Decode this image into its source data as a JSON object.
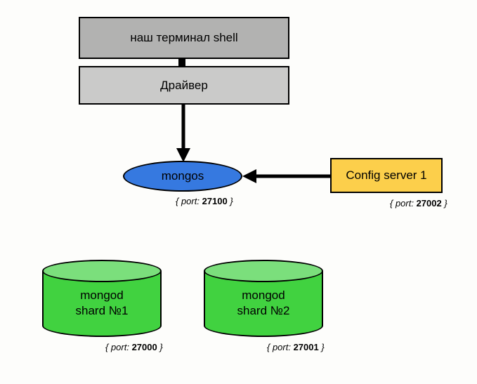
{
  "terminal": {
    "label": "наш терминал shell"
  },
  "driver": {
    "label": "Драйвер"
  },
  "mongos": {
    "label": "mongos",
    "port": "27100"
  },
  "config": {
    "label": "Config server 1",
    "port": "27002"
  },
  "shard1": {
    "label1": "mongod",
    "label2": "shard №1",
    "port": "27000"
  },
  "shard2": {
    "label1": "mongod",
    "label2": "shard №2",
    "port": "27001"
  },
  "portPrefix": "{ port: ",
  "portSuffix": " }"
}
